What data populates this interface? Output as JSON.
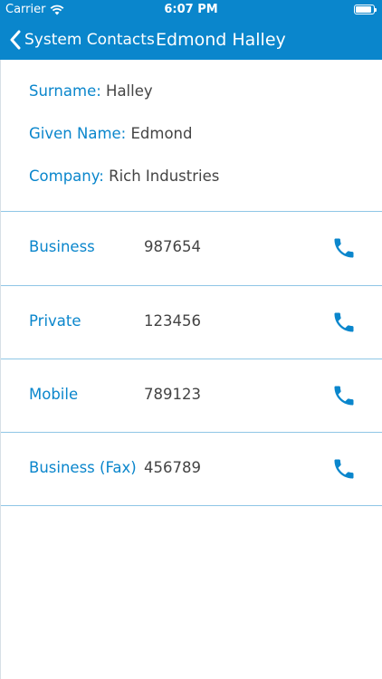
{
  "status_bar": {
    "carrier": "Carrier",
    "time": "6:07 PM",
    "battery_level": 0.9
  },
  "nav": {
    "back_label": "System Contacts",
    "title": "Edmond Halley"
  },
  "contact": {
    "surname_label": "Surname:",
    "surname": "Halley",
    "given_name_label": "Given Name:",
    "given_name": "Edmond",
    "company_label": "Company:",
    "company": "Rich Industries"
  },
  "phones": [
    {
      "label": "Business",
      "number": "987654"
    },
    {
      "label": "Private",
      "number": "123456"
    },
    {
      "label": "Mobile",
      "number": "789123"
    },
    {
      "label": "Business (Fax)",
      "number": "456789"
    }
  ],
  "colors": {
    "accent": "#0a86cc",
    "divider": "#8fc6e6",
    "value_text": "#444444"
  },
  "icons": {
    "back": "chevron-left-icon",
    "call": "phone-icon",
    "wifi": "wifi-icon",
    "battery": "battery-icon"
  }
}
